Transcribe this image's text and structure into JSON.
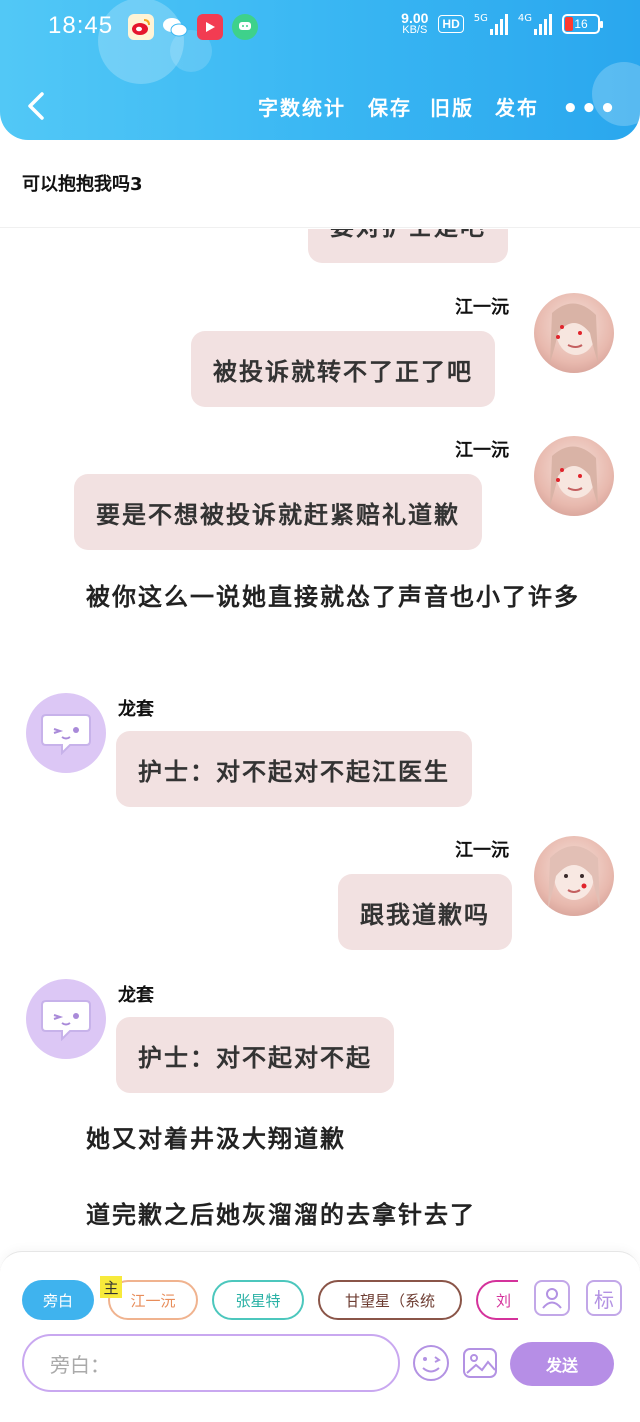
{
  "status_bar": {
    "time": "18:45",
    "speed_value": "9.00",
    "speed_unit": "KB/S",
    "hd_label": "HD",
    "net_5g": "5G",
    "net_4g": "4G",
    "battery": "16",
    "app_icons": [
      "weibo-icon",
      "wechat-icon",
      "video-app-icon",
      "chat-app-icon"
    ]
  },
  "nav": {
    "actions": [
      "字数统计",
      "保存",
      "旧版",
      "发布"
    ],
    "more": "•••"
  },
  "document": {
    "title": "可以抱抱我吗3"
  },
  "messages": [
    {
      "type": "bubble",
      "side": "right",
      "speaker": "",
      "text": "要对护士是吧"
    },
    {
      "type": "bubble",
      "side": "right",
      "speaker": "江一沅",
      "text": "被投诉就转不了正了吧"
    },
    {
      "type": "bubble",
      "side": "right",
      "speaker": "江一沅",
      "text": "要是不想被投诉就赶紧赔礼道歉"
    },
    {
      "type": "narration",
      "text": "被你这么一说她直接就怂了声音也小了许多"
    },
    {
      "type": "bubble",
      "side": "left",
      "speaker": "龙套",
      "text": "护士：对不起对不起江医生"
    },
    {
      "type": "bubble",
      "side": "right",
      "speaker": "江一沅",
      "text": "跟我道歉吗"
    },
    {
      "type": "bubble",
      "side": "left",
      "speaker": "龙套",
      "text": "护士：对不起对不起"
    },
    {
      "type": "narration",
      "text": "她又对着井汲大翔道歉"
    },
    {
      "type": "narration",
      "text": "道完歉之后她灰溜溜的去拿针去了"
    }
  ],
  "composer": {
    "chips": [
      "旁白",
      "江一沅",
      "张星特",
      "甘望星（系统",
      "刘"
    ],
    "main_tag": "主",
    "tool_label": "标",
    "input_placeholder": "旁白：",
    "send_label": "发送"
  },
  "colors": {
    "header": "#3ab7f3",
    "bubble": "#f2e1e1",
    "accent_purple": "#b68ee6",
    "chip_active": "#3fb3ee"
  }
}
